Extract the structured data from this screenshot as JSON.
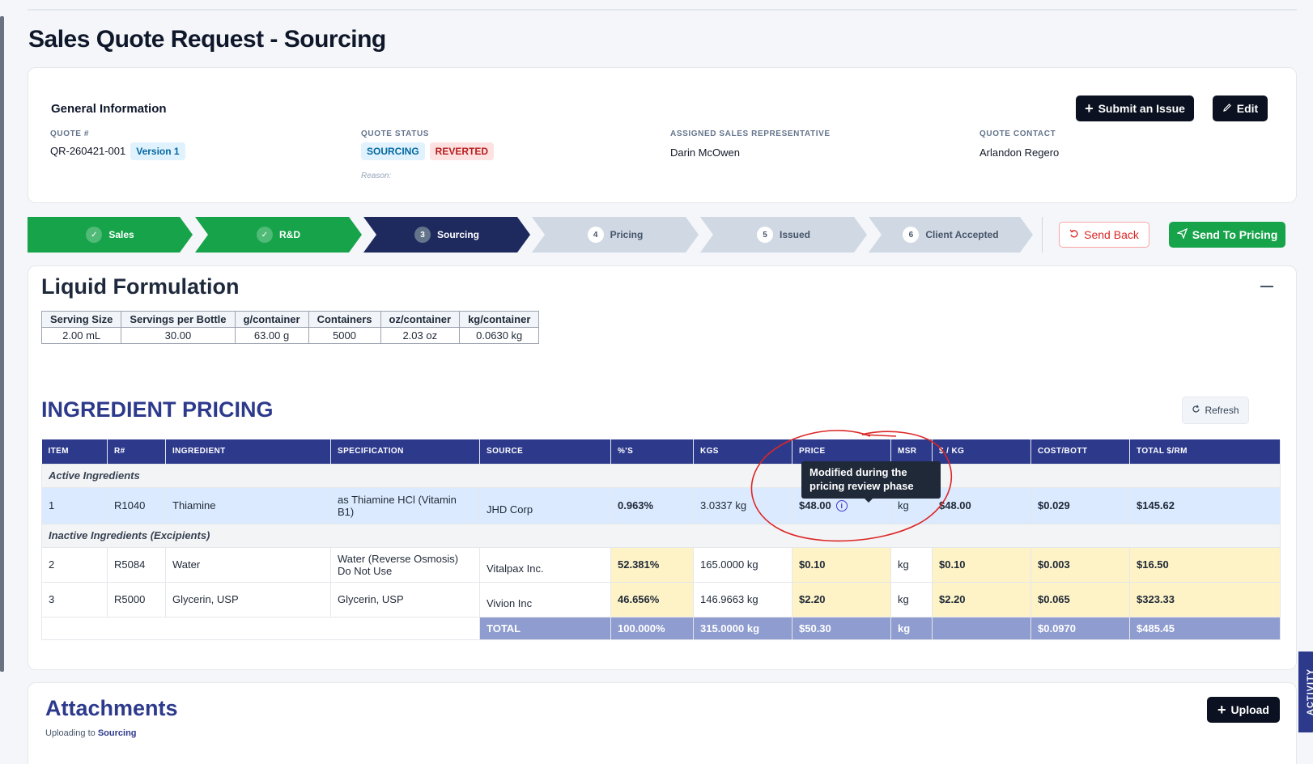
{
  "page": {
    "title": "Sales Quote Request - Sourcing"
  },
  "general": {
    "title": "General Information",
    "submit_issue_label": "Submit an Issue",
    "edit_label": "Edit",
    "quote_number_label": "QUOTE #",
    "quote_number": "QR-260421-001",
    "version": "Version 1",
    "quote_status_label": "QUOTE STATUS",
    "status_primary": "SOURCING",
    "status_secondary": "REVERTED",
    "reason_label": "Reason:",
    "rep_label": "ASSIGNED SALES REPRESENTATIVE",
    "rep": "Darin McOwen",
    "contact_label": "QUOTE CONTACT",
    "contact": "Arlandon Regero"
  },
  "stepper": {
    "steps": [
      {
        "label": "Sales",
        "marker": "✓"
      },
      {
        "label": "R&D",
        "marker": "✓"
      },
      {
        "label": "Sourcing",
        "marker": "3"
      },
      {
        "label": "Pricing",
        "marker": "4"
      },
      {
        "label": "Issued",
        "marker": "5"
      },
      {
        "label": "Client Accepted",
        "marker": "6"
      }
    ],
    "send_back_label": "Send Back",
    "send_to_pricing_label": "Send To Pricing"
  },
  "formulation": {
    "title": "Liquid Formulation",
    "headers": [
      "Serving Size",
      "Servings per Bottle",
      "g/container",
      "Containers",
      "oz/container",
      "kg/container"
    ],
    "values": [
      "2.00 mL",
      "30.00",
      "63.00 g",
      "5000",
      "2.03 oz",
      "0.0630 kg"
    ]
  },
  "pricing": {
    "title": "INGREDIENT PRICING",
    "refresh_label": "Refresh",
    "headers": [
      "ITEM",
      "R#",
      "INGREDIENT",
      "SPECIFICATION",
      "SOURCE",
      "%'S",
      "KGS",
      "PRICE",
      "MSR",
      "$ / KG",
      "COST/BOTT",
      "TOTAL $/RM"
    ],
    "group_active": "Active Ingredients",
    "group_inactive": "Inactive Ingredients (Excipients)",
    "rows": [
      {
        "item": "1",
        "r": "R1040",
        "ingredient": "Thiamine",
        "spec": "as Thiamine HCl (Vitamin B1)",
        "source": "JHD Corp",
        "pct": "0.963%",
        "kgs": "3.0337 kg",
        "price": "$48.00",
        "msr": "kg",
        "per_kg": "$48.00",
        "cost": "$0.029",
        "total": "$145.62"
      },
      {
        "item": "2",
        "r": "R5084",
        "ingredient": "Water",
        "spec": "Water (Reverse Osmosis) Do Not Use",
        "source": "Vitalpax Inc.",
        "pct": "52.381%",
        "kgs": "165.0000 kg",
        "price": "$0.10",
        "msr": "kg",
        "per_kg": "$0.10",
        "cost": "$0.003",
        "total": "$16.50"
      },
      {
        "item": "3",
        "r": "R5000",
        "ingredient": "Glycerin, USP",
        "spec": "Glycerin, USP",
        "source": "Vivion Inc",
        "pct": "46.656%",
        "kgs": "146.9663 kg",
        "price": "$2.20",
        "msr": "kg",
        "per_kg": "$2.20",
        "cost": "$0.065",
        "total": "$323.33"
      }
    ],
    "total": {
      "label": "TOTAL",
      "pct": "100.000%",
      "kgs": "315.0000 kg",
      "price": "$50.30",
      "msr": "kg",
      "per_kg": "",
      "cost": "$0.0970",
      "total": "$485.45"
    },
    "tooltip": "Modified during the pricing review phase"
  },
  "attachments": {
    "title": "Attachments",
    "sub_prefix": "Uploading to",
    "sub_target": "Sourcing",
    "upload_label": "Upload"
  },
  "activity_label": "ACTIVITY"
}
